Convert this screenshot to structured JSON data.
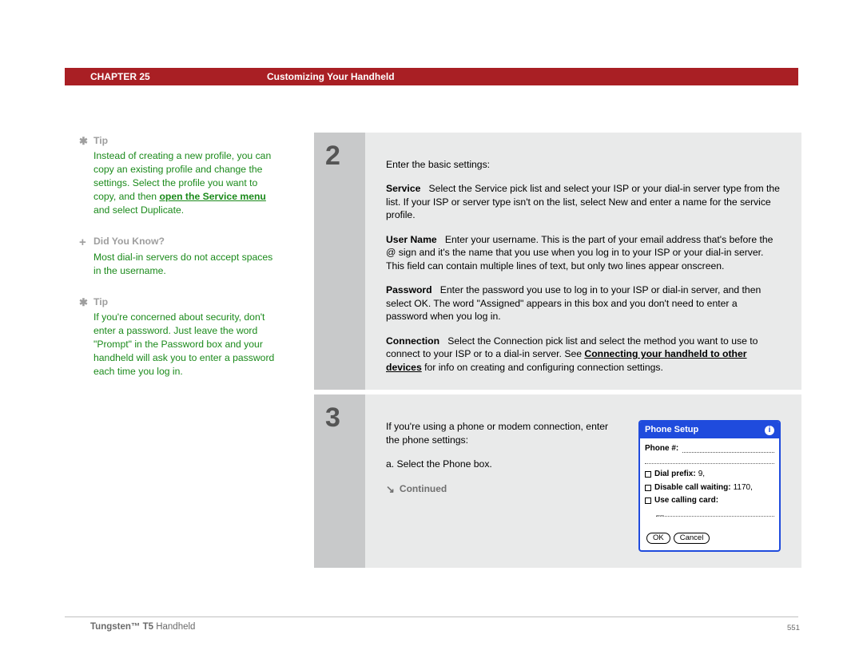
{
  "header": {
    "chapter": "CHAPTER 25",
    "title": "Customizing Your Handheld"
  },
  "sidebar": {
    "tip1": {
      "label": "Tip",
      "body_a": "Instead of creating a new profile, you can copy an existing profile and change the settings. Select the profile you want to copy, and then ",
      "link": "open the Service menu",
      "body_b": " and select Duplicate."
    },
    "dyk": {
      "label": "Did You Know?",
      "body": "Most dial-in servers do not accept spaces in the username."
    },
    "tip2": {
      "label": "Tip",
      "body": "If you're concerned about security, don't enter a password. Just leave the word \"Prompt\" in the Password box and your handheld will ask you to enter a password each time you log in."
    }
  },
  "steps": {
    "s2": {
      "num": "2",
      "intro": "Enter the basic settings:",
      "service_label": "Service",
      "service_text": "Select the Service pick list and select your ISP or your dial-in server type from the list. If your ISP or server type isn't on the list, select New and enter a name for the service profile.",
      "user_label": "User Name",
      "user_text": "Enter your username. This is the part of your email address that's before the @ sign and it's the name that you use when you log in to your ISP or your dial-in server. This field can contain multiple lines of text, but only two lines appear onscreen.",
      "pass_label": "Password",
      "pass_text": "Enter the password you use to log in to your ISP or dial-in server, and then select OK. The word \"Assigned\" appears in this box and you don't need to enter a password when you log in.",
      "conn_label": "Connection",
      "conn_text_a": "Select the Connection pick list and select the method you want to use to connect to your ISP or to a dial-in server. See ",
      "conn_link": "Connecting your handheld to other devices",
      "conn_text_b": " for info on creating and configuring connection settings."
    },
    "s3": {
      "num": "3",
      "intro": "If you're using a phone or modem connection, enter the phone settings:",
      "a": "a.  Select the Phone box.",
      "continued": "Continued"
    }
  },
  "phone_box": {
    "title": "Phone Setup",
    "phone_num": "Phone #:",
    "dial_prefix": "Dial prefix:",
    "dial_prefix_val": "9,",
    "disable_cw": "Disable call waiting:",
    "disable_cw_val": "1170,",
    "use_card": "Use calling card:",
    "ok": "OK",
    "cancel": "Cancel"
  },
  "footer": {
    "product_a": "Tungsten™ T5",
    "product_b": " Handheld",
    "page": "551"
  }
}
